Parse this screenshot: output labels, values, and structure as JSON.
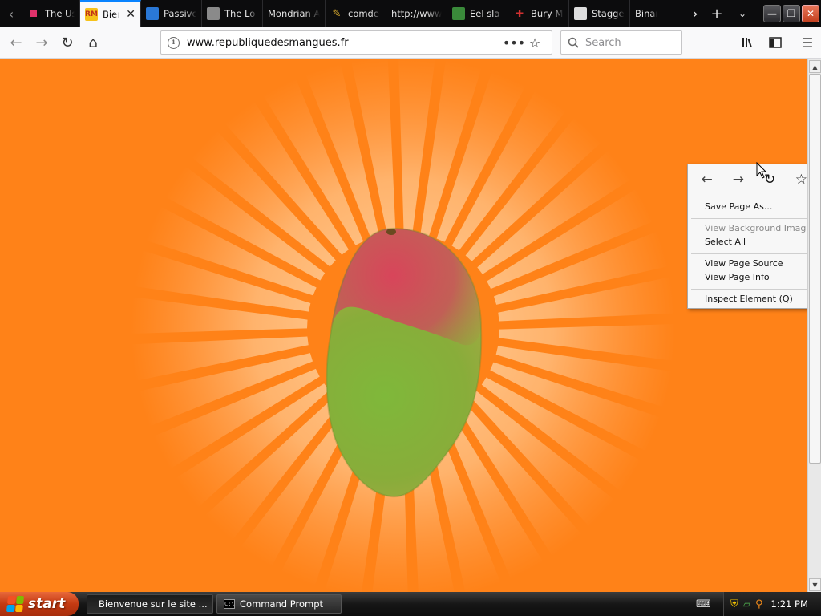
{
  "browser": {
    "tabs": [
      {
        "label": "The Us",
        "favicon": "pink-square-icon",
        "color": "#e0326b"
      },
      {
        "label": "Bienvenue",
        "favicon": "rm-logo-icon",
        "color": "#f6c21a",
        "active": true
      },
      {
        "label": "Passive",
        "favicon": "blue-card-icon",
        "color": "#2a78d6"
      },
      {
        "label": "The Lo",
        "favicon": "photo-icon",
        "color": "#888888"
      },
      {
        "label": "Mondrian A",
        "favicon": "",
        "color": ""
      },
      {
        "label": "comde",
        "favicon": "pencil-icon",
        "color": "#e0b030"
      },
      {
        "label": "http://www",
        "favicon": "",
        "color": ""
      },
      {
        "label": "Eel sla",
        "favicon": "eel-icon",
        "color": "#3a8a3a"
      },
      {
        "label": "Bury M",
        "favicon": "cross-icon",
        "color": "#d03030"
      },
      {
        "label": "Stagge",
        "favicon": "blank-page-icon",
        "color": "#dddddd"
      },
      {
        "label": "Binary",
        "favicon": "",
        "color": ""
      }
    ],
    "favicon_rm_text": "RM",
    "url": "www.republiquedesmangues.fr",
    "search_placeholder": "Search"
  },
  "context_menu": {
    "nav_icons": [
      "back-arrow-icon",
      "forward-arrow-icon",
      "reload-icon",
      "bookmark-star-icon"
    ],
    "items": [
      {
        "label": "Save Page As...",
        "enabled": true
      },
      {
        "label": "View Background Image",
        "enabled": false
      },
      {
        "label": "Select All",
        "enabled": true
      },
      {
        "label": "View Page Source",
        "enabled": true
      },
      {
        "label": "View Page Info",
        "enabled": true
      },
      {
        "label": "Inspect Element (Q)",
        "enabled": true
      }
    ]
  },
  "page": {
    "background_color": "#ff8218",
    "hero_image": "mango-icon"
  },
  "taskbar": {
    "start_label": "start",
    "tasks": [
      {
        "label": "Bienvenue sur le site ...",
        "icon": "firefox-icon",
        "active": true
      },
      {
        "label": "Command Prompt",
        "icon": "cmd-icon",
        "active": false
      }
    ],
    "clock": "1:21 PM"
  }
}
